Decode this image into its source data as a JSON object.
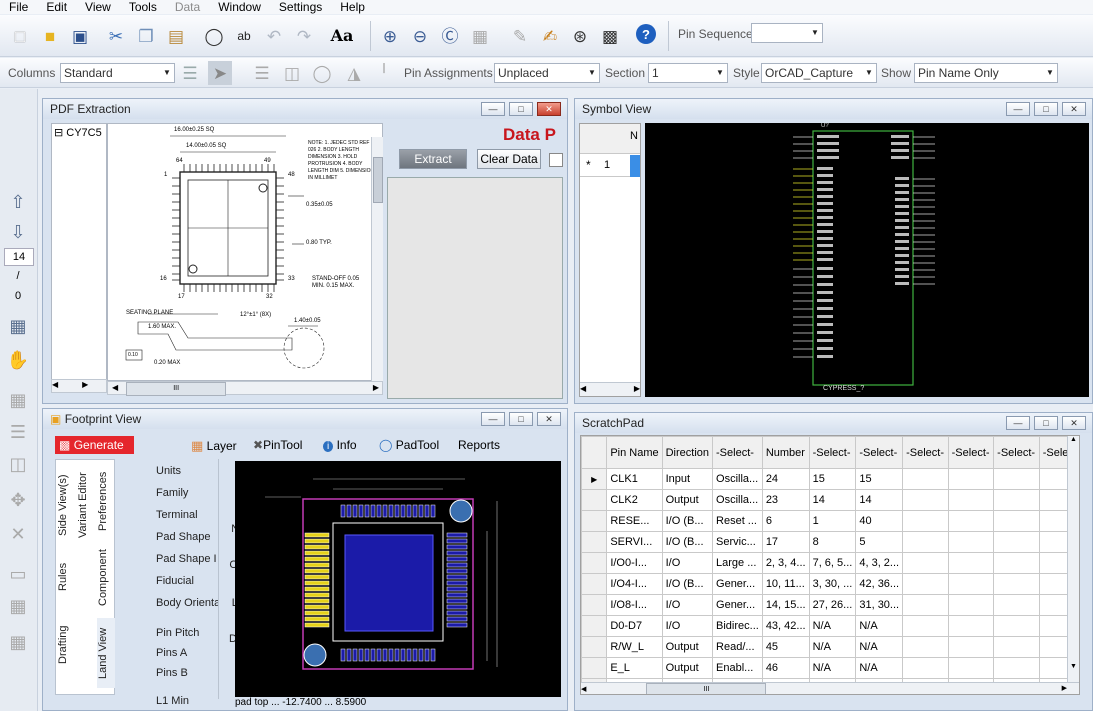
{
  "menu": [
    "File",
    "Edit",
    "View",
    "Tools",
    "Data",
    "Window",
    "Settings",
    "Help"
  ],
  "toolbar1": {
    "icons": [
      "new-file-icon",
      "open-folder-icon",
      "save-icon",
      "cut-icon",
      "copy-icon",
      "paste-icon",
      "find-icon",
      "spell-check-icon",
      "undo-icon",
      "redo-icon",
      "font-icon",
      "zoom-in-icon",
      "zoom-out-icon",
      "zoom-fit-icon",
      "zoom-area-icon",
      "pen-icon",
      "edit-icon",
      "pin-icon",
      "chip-icon",
      "help-icon"
    ],
    "pin_sequence_label": "Pin Sequence",
    "pin_sequence_value": ""
  },
  "toolbar2": {
    "columns_label": "Columns",
    "columns_value": "Standard",
    "pin_assign_label": "Pin Assignments",
    "pin_assign_value": "Unplaced",
    "section_label": "Section",
    "section_value": "1",
    "style_label": "Style",
    "style_value": "OrCAD_Capture",
    "show_label": "Show",
    "show_value": "Pin Name Only"
  },
  "leftbar": {
    "page_value": "14",
    "page_sep": "/",
    "page_total": "0"
  },
  "pdf_panel": {
    "title": "PDF Extraction",
    "tree_item": "CY7C5",
    "data_label": "Data P",
    "extract_btn": "Extract",
    "clear_btn": "Clear Data",
    "scroll_mid": "III"
  },
  "drawing_labels": {
    "dim1": "16.00±0.25 SQ",
    "dim2": "14.00±0.05 SQ",
    "notes": "NOTE: 1. JEDEC STD REF MS-026 2. BODY LENGTH DIMENSION 3. HOLD PROTRUSION 4. BODY LENGTH DIM 5. DIMENSIONS IN MILLIMET",
    "d035": "0.35±0.05",
    "d080": "0.80 TYP.",
    "standoff": "STAND-OFF 0.05 MIN. 0.15 MAX.",
    "seating": "SEATING PLANE",
    "d160": "1.60 MAX.",
    "d140": "1.40±0.05",
    "d020": "0.20 MAX",
    "d010": "0.10",
    "angle": "12°±1° (8X)",
    "pin64": "64",
    "pin49": "49",
    "pin48": "48",
    "pin1": "1",
    "pin16": "16",
    "pin17": "17",
    "pin32": "32",
    "pin33": "33"
  },
  "symbol_panel": {
    "title": "Symbol View",
    "row_label": "1",
    "row_marker": "*",
    "col_header": "N",
    "part_ref": "U?",
    "part_name": "CYPRESS_?"
  },
  "footprint_panel": {
    "title": "Footprint View",
    "generate": "Generate",
    "tools": [
      "Layer",
      "PinTool",
      "Info",
      "PadTool",
      "Reports"
    ],
    "vtabs": [
      "Side View(s)",
      "Variant Editor",
      "Preferences",
      "Rules",
      "Component",
      "Drafting",
      "Land View"
    ],
    "fields": [
      "Units",
      "Family",
      "Terminal",
      "Pad Shape",
      "Pad Shape I",
      "Fiducial",
      "Body Orienta",
      "Pin Pitch",
      "Pins A",
      "Pins B",
      "L1 Min"
    ],
    "tools_right": [
      "Calc",
      "NoDim",
      "CompD",
      "LandD",
      "Dimen1",
      "Done"
    ],
    "status": "pad top ... -12.7400 ... 8.5900"
  },
  "scratch_panel": {
    "title": "ScratchPad",
    "headers": [
      "Pin Name",
      "Direction",
      "-Select-",
      "Number",
      "-Select-",
      "-Select-",
      "-Select-",
      "-Select-",
      "-Select-",
      "-Selec"
    ],
    "rows": [
      [
        "CLK1",
        "Input",
        "Oscilla...",
        "24",
        "15",
        "15",
        "",
        "",
        "",
        ""
      ],
      [
        "CLK2",
        "Output",
        "Oscilla...",
        "23",
        "14",
        "14",
        "",
        "",
        "",
        ""
      ],
      [
        "RESE...",
        "I/O (B...",
        "Reset ...",
        "6",
        "1",
        "40",
        "",
        "",
        "",
        ""
      ],
      [
        "SERVI...",
        "I/O (B...",
        "Servic...",
        "17",
        "8",
        "5",
        "",
        "",
        "",
        ""
      ],
      [
        "I/O0-I...",
        "I/O",
        "Large ...",
        "2, 3, 4...",
        "7, 6, 5...",
        "4, 3, 2...",
        "",
        "",
        "",
        ""
      ],
      [
        "I/O4-I...",
        "I/O (B...",
        "Gener...",
        "10, 11...",
        "3, 30, ...",
        "42, 36...",
        "",
        "",
        "",
        ""
      ],
      [
        "I/O8-I...",
        "I/O",
        "Gener...",
        "14, 15...",
        "27, 26...",
        "31, 30...",
        "",
        "",
        "",
        ""
      ],
      [
        "D0-D7",
        "I/O",
        "Bidirec...",
        "43, 42...",
        "N/A",
        "N/A",
        "",
        "",
        "",
        ""
      ],
      [
        "R/W_L",
        "Output",
        "Read/...",
        "45",
        "N/A",
        "N/A",
        "",
        "",
        "",
        ""
      ],
      [
        "E_L",
        "Output",
        "Enabl...",
        "46",
        "N/A",
        "N/A",
        "",
        "",
        "",
        ""
      ],
      [
        "A0-A15",
        "Output",
        "Memor...",
        "64, 63...",
        "N/A",
        "N/A",
        "",
        "",
        "",
        ""
      ]
    ],
    "scroll_mid": "III"
  }
}
